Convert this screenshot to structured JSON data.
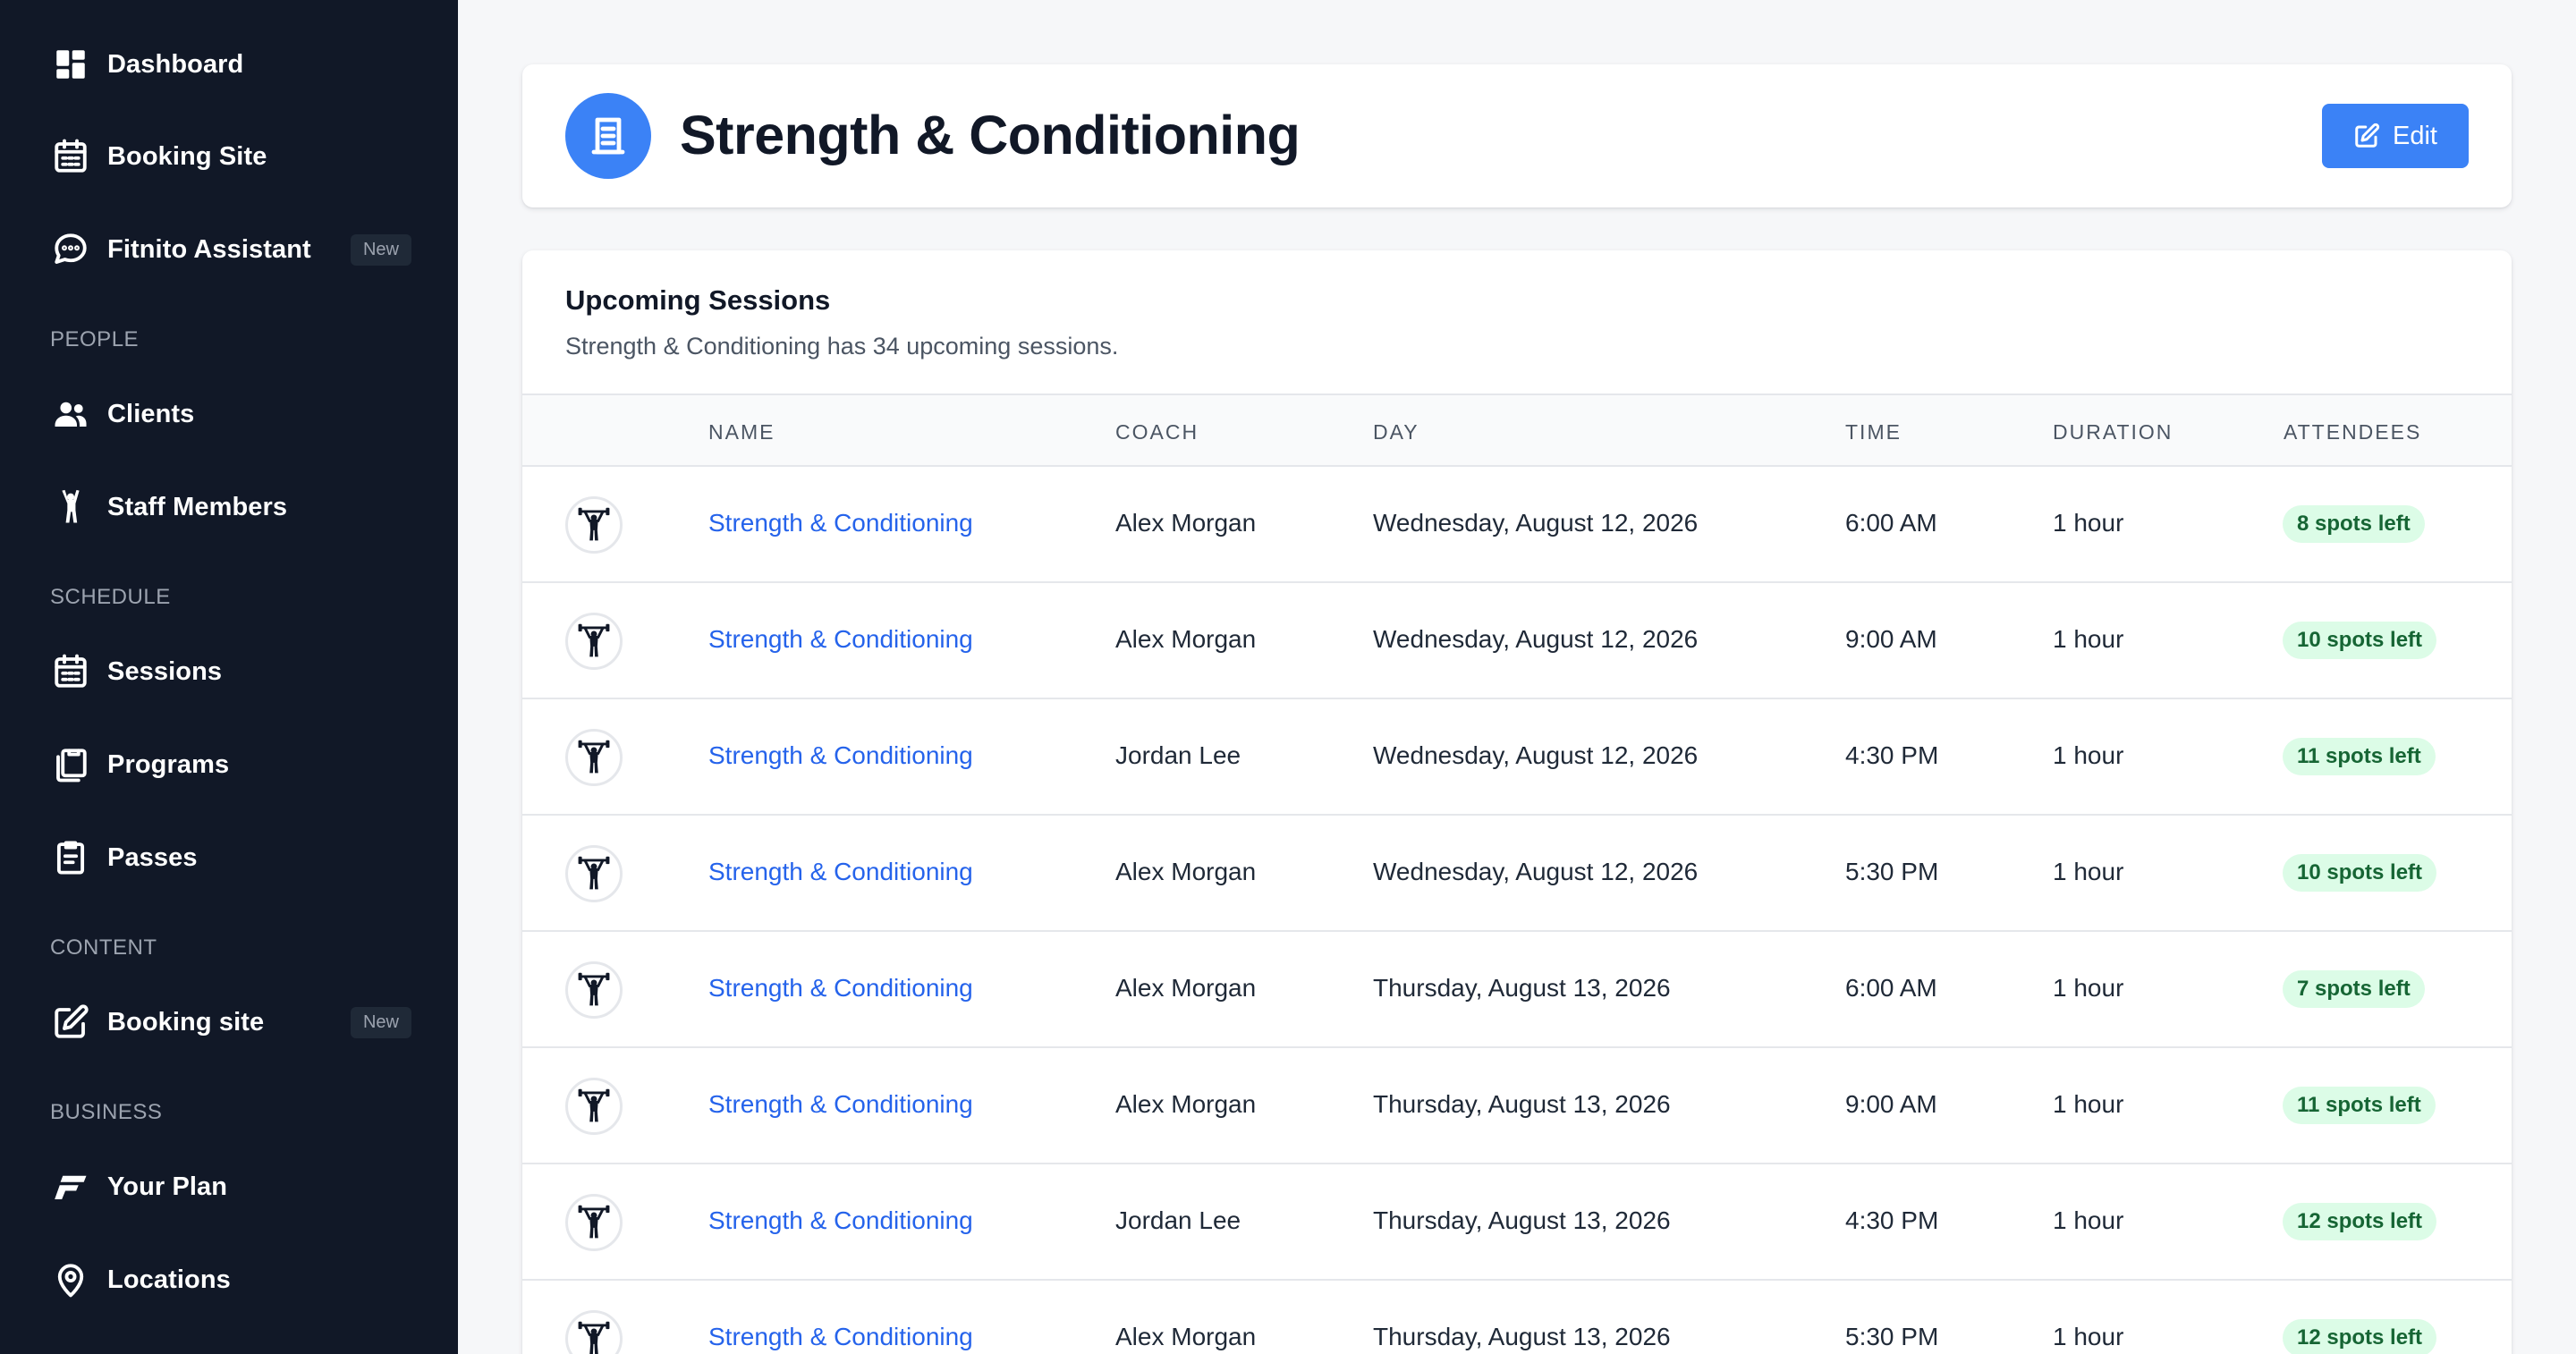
{
  "sidebar": {
    "items": [
      {
        "label": "Dashboard",
        "icon": "dashboard-icon"
      },
      {
        "label": "Booking Site",
        "icon": "calendar-icon"
      },
      {
        "label": "Fitnito Assistant",
        "icon": "chat-bubble-icon",
        "badge": "New"
      },
      {
        "label": "Clients",
        "icon": "users-icon"
      },
      {
        "label": "Staff Members",
        "icon": "person-raised-arms-icon"
      },
      {
        "label": "Sessions",
        "icon": "calendar-icon"
      },
      {
        "label": "Programs",
        "icon": "clipboard-stack-icon"
      },
      {
        "label": "Passes",
        "icon": "clipboard-icon"
      },
      {
        "label": "Booking site",
        "icon": "edit-square-icon",
        "badge": "New"
      },
      {
        "label": "Your Plan",
        "icon": "brand-f-icon"
      },
      {
        "label": "Locations",
        "icon": "map-pin-icon"
      }
    ],
    "sections": {
      "people": "PEOPLE",
      "schedule": "SCHEDULE",
      "content": "CONTENT",
      "business": "BUSINESS"
    }
  },
  "header": {
    "title": "Strength & Conditioning",
    "icon": "document-icon",
    "edit_label": "Edit"
  },
  "sessions": {
    "title": "Upcoming Sessions",
    "subtitle": "Strength & Conditioning has 34 upcoming sessions.",
    "columns": [
      "NAME",
      "COACH",
      "DAY",
      "TIME",
      "DURATION",
      "ATTENDEES"
    ],
    "rows": [
      {
        "name": "Strength & Conditioning",
        "coach": "Alex Morgan",
        "day": "Wednesday, August 12, 2026",
        "time": "6:00 AM",
        "duration": "1 hour",
        "attendees": "8 spots left"
      },
      {
        "name": "Strength & Conditioning",
        "coach": "Alex Morgan",
        "day": "Wednesday, August 12, 2026",
        "time": "9:00 AM",
        "duration": "1 hour",
        "attendees": "10 spots left"
      },
      {
        "name": "Strength & Conditioning",
        "coach": "Jordan Lee",
        "day": "Wednesday, August 12, 2026",
        "time": "4:30 PM",
        "duration": "1 hour",
        "attendees": "11 spots left"
      },
      {
        "name": "Strength & Conditioning",
        "coach": "Alex Morgan",
        "day": "Wednesday, August 12, 2026",
        "time": "5:30 PM",
        "duration": "1 hour",
        "attendees": "10 spots left"
      },
      {
        "name": "Strength & Conditioning",
        "coach": "Alex Morgan",
        "day": "Thursday, August 13, 2026",
        "time": "6:00 AM",
        "duration": "1 hour",
        "attendees": "7 spots left"
      },
      {
        "name": "Strength & Conditioning",
        "coach": "Alex Morgan",
        "day": "Thursday, August 13, 2026",
        "time": "9:00 AM",
        "duration": "1 hour",
        "attendees": "11 spots left"
      },
      {
        "name": "Strength & Conditioning",
        "coach": "Jordan Lee",
        "day": "Thursday, August 13, 2026",
        "time": "4:30 PM",
        "duration": "1 hour",
        "attendees": "12 spots left"
      },
      {
        "name": "Strength & Conditioning",
        "coach": "Alex Morgan",
        "day": "Thursday, August 13, 2026",
        "time": "5:30 PM",
        "duration": "1 hour",
        "attendees": "12 spots left"
      }
    ],
    "row_icon": "weightlifter-icon"
  },
  "colors": {
    "sidebar_bg": "#111827",
    "accent": "#3b82f6",
    "link": "#2563eb",
    "badge_bg": "#dcfce7",
    "badge_text": "#166534"
  }
}
